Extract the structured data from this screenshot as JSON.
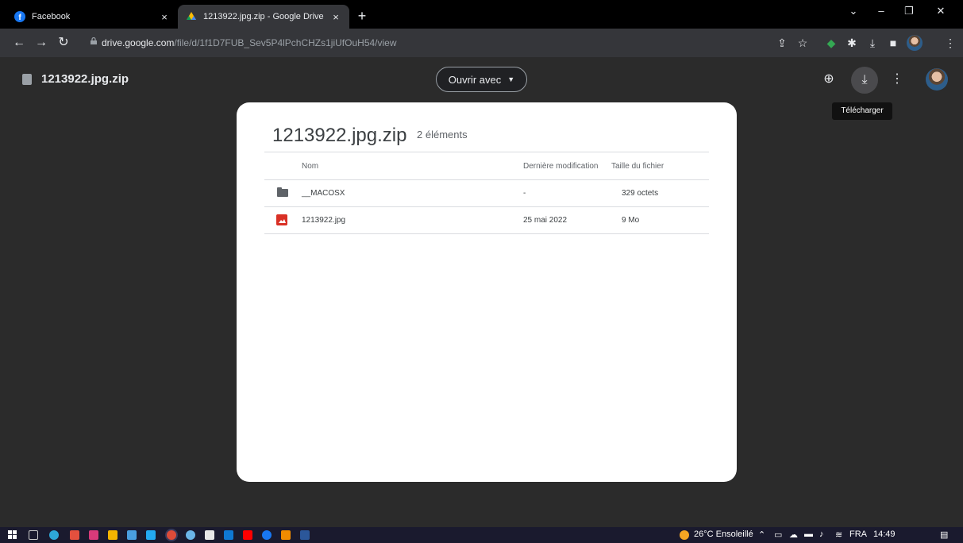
{
  "browser": {
    "tabs": [
      {
        "title": "Facebook",
        "close": "×"
      },
      {
        "title": "1213922.jpg.zip - Google Drive",
        "close": "×"
      }
    ],
    "new_tab": "+",
    "url_host": "drive.google.com",
    "url_path": "/file/d/1f1D7FUB_Sev5P4lPchCHZs1jiUfOuH54/view"
  },
  "drive": {
    "file_name": "1213922.jpg.zip",
    "open_with": "Ouvrir avec",
    "download_tooltip": "Télécharger"
  },
  "archive": {
    "title": "1213922.jpg.zip",
    "count": "2 éléments",
    "columns": {
      "name": "Nom",
      "modified": "Dernière modification",
      "size": "Taille du fichier"
    },
    "rows": [
      {
        "icon": "folder-icon",
        "name": "__MACOSX",
        "modified": "-",
        "size": "329 octets"
      },
      {
        "icon": "image-icon",
        "name": "1213922.jpg",
        "modified": "25 mai 2022",
        "size": "9 Mo"
      }
    ]
  },
  "taskbar": {
    "weather": "26°C Ensoleillé",
    "language": "FRA",
    "time": "14:49"
  },
  "colors": {
    "background": "#2b2b2b",
    "card": "#ffffff",
    "tooltip": "#111111"
  }
}
